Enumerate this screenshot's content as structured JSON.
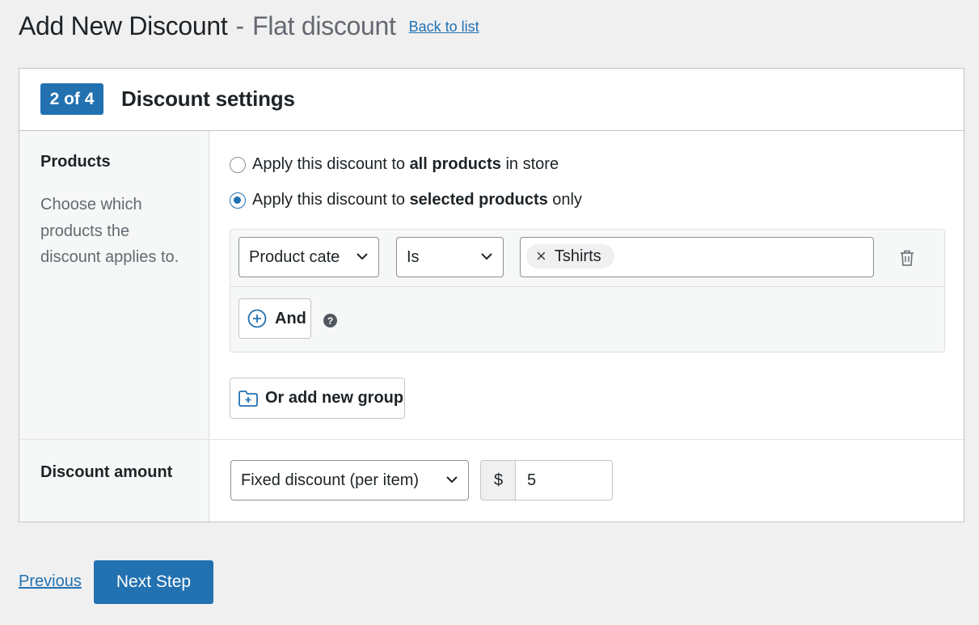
{
  "header": {
    "title": "Add New Discount",
    "separator": "-",
    "subtitle": "Flat discount",
    "back_link": "Back to list"
  },
  "card": {
    "step_badge": "2 of 4",
    "title": "Discount settings"
  },
  "products": {
    "label": "Products",
    "description": "Choose which products the discount applies to.",
    "options": [
      {
        "prefix": "Apply this discount to ",
        "bold": "all products",
        "suffix": " in store",
        "checked": false
      },
      {
        "prefix": "Apply this discount to ",
        "bold": "selected products",
        "suffix": " only",
        "checked": true
      }
    ],
    "condition": {
      "field_value": "Product cate",
      "operator_value": "Is",
      "tags": [
        "Tshirts"
      ],
      "tag_remove": "×"
    },
    "and_button": "And",
    "help": "?",
    "add_group_button": "Or add new group"
  },
  "amount": {
    "label": "Discount amount",
    "type_value": "Fixed discount (per item)",
    "currency": "$",
    "value": "5"
  },
  "footer": {
    "previous": "Previous",
    "next": "Next Step"
  },
  "colors": {
    "primary": "#2271b1",
    "background": "#f0f0f1",
    "text": "#1d2327",
    "muted": "#646970"
  },
  "icons": [
    "chevron-down-icon",
    "close-icon",
    "trash-icon",
    "plus-circle-icon",
    "help-icon",
    "folder-plus-icon"
  ]
}
